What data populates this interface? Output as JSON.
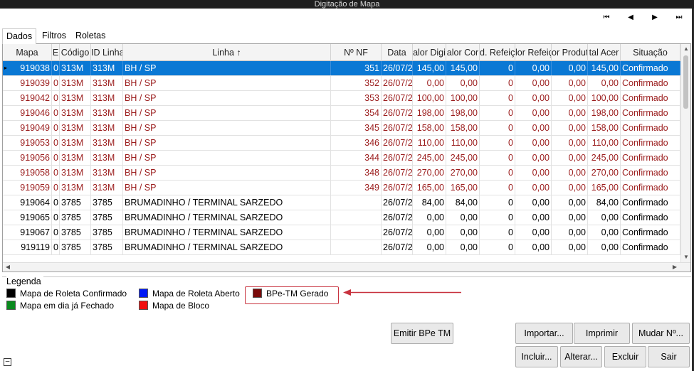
{
  "window": {
    "title": "Digitação de Mapa"
  },
  "nav": {
    "first": "⏮",
    "prev": "◀",
    "next": "▶",
    "last": "⏭"
  },
  "tabs": [
    {
      "label": "Dados"
    },
    {
      "label": "Filtros"
    },
    {
      "label": "Roletas"
    }
  ],
  "grid": {
    "columns": [
      "Mapa",
      "E",
      "Código",
      "ID Linha",
      "Linha ↑",
      "Nº NF",
      "Data",
      "alor Digi",
      "alor Cor",
      "d. Refeiç",
      "lor Refeiç",
      "or Produt",
      "tal Acer",
      "Situação"
    ],
    "rows": [
      {
        "style": "sel",
        "cells": [
          "919038",
          "0",
          "313M",
          "313M",
          "BH / SP",
          "351",
          "26/07/2",
          "145,00",
          "145,00",
          "0",
          "0,00",
          "0,00",
          "145,00",
          "Confirmado"
        ]
      },
      {
        "style": "red",
        "cells": [
          "919039",
          "0",
          "313M",
          "313M",
          "BH / SP",
          "352",
          "26/07/2",
          "0,00",
          "0,00",
          "0",
          "0,00",
          "0,00",
          "0,00",
          "Confirmado"
        ]
      },
      {
        "style": "red",
        "cells": [
          "919042",
          "0",
          "313M",
          "313M",
          "BH / SP",
          "353",
          "26/07/2",
          "100,00",
          "100,00",
          "0",
          "0,00",
          "0,00",
          "100,00",
          "Confirmado"
        ]
      },
      {
        "style": "red",
        "cells": [
          "919046",
          "0",
          "313M",
          "313M",
          "BH / SP",
          "354",
          "26/07/2",
          "198,00",
          "198,00",
          "0",
          "0,00",
          "0,00",
          "198,00",
          "Confirmado"
        ]
      },
      {
        "style": "red",
        "cells": [
          "919049",
          "0",
          "313M",
          "313M",
          "BH / SP",
          "345",
          "26/07/2",
          "158,00",
          "158,00",
          "0",
          "0,00",
          "0,00",
          "158,00",
          "Confirmado"
        ]
      },
      {
        "style": "red",
        "cells": [
          "919053",
          "0",
          "313M",
          "313M",
          "BH / SP",
          "346",
          "26/07/2",
          "110,00",
          "110,00",
          "0",
          "0,00",
          "0,00",
          "110,00",
          "Confirmado"
        ]
      },
      {
        "style": "red",
        "cells": [
          "919056",
          "0",
          "313M",
          "313M",
          "BH / SP",
          "344",
          "26/07/2",
          "245,00",
          "245,00",
          "0",
          "0,00",
          "0,00",
          "245,00",
          "Confirmado"
        ]
      },
      {
        "style": "red",
        "cells": [
          "919058",
          "0",
          "313M",
          "313M",
          "BH / SP",
          "348",
          "26/07/2",
          "270,00",
          "270,00",
          "0",
          "0,00",
          "0,00",
          "270,00",
          "Confirmado"
        ]
      },
      {
        "style": "red",
        "cells": [
          "919059",
          "0",
          "313M",
          "313M",
          "BH / SP",
          "349",
          "26/07/2",
          "165,00",
          "165,00",
          "0",
          "0,00",
          "0,00",
          "165,00",
          "Confirmado"
        ]
      },
      {
        "style": "black",
        "cells": [
          "919064",
          "0",
          "3785",
          "3785",
          "BRUMADINHO / TERMINAL SARZEDO",
          "",
          "26/07/2",
          "84,00",
          "84,00",
          "0",
          "0,00",
          "0,00",
          "84,00",
          "Confirmado"
        ]
      },
      {
        "style": "black",
        "cells": [
          "919065",
          "0",
          "3785",
          "3785",
          "BRUMADINHO / TERMINAL SARZEDO",
          "",
          "26/07/2",
          "0,00",
          "0,00",
          "0",
          "0,00",
          "0,00",
          "0,00",
          "Confirmado"
        ]
      },
      {
        "style": "black",
        "cells": [
          "919067",
          "0",
          "3785",
          "3785",
          "BRUMADINHO / TERMINAL SARZEDO",
          "",
          "26/07/2",
          "0,00",
          "0,00",
          "0",
          "0,00",
          "0,00",
          "0,00",
          "Confirmado"
        ]
      },
      {
        "style": "black",
        "cells": [
          "919119",
          "0",
          "3785",
          "3785",
          "BRUMADINHO / TERMINAL SARZEDO",
          "",
          "26/07/2",
          "0,00",
          "0,00",
          "0",
          "0,00",
          "0,00",
          "0,00",
          "Confirmado"
        ]
      }
    ]
  },
  "legend": {
    "title": "Legenda",
    "items": [
      {
        "label": "Mapa de Roleta Confirmado",
        "color": "#000000"
      },
      {
        "label": "Mapa em dia já Fechado",
        "color": "#0a8a1e"
      },
      {
        "label": "Mapa de Roleta Aberto",
        "color": "#0018f5"
      },
      {
        "label": "Mapa de Bloco",
        "color": "#f20e0e"
      },
      {
        "label": "BPe-TM Gerado",
        "color": "#7a0a0a"
      }
    ],
    "highlight_color": "#c8323e"
  },
  "buttons": {
    "emitir": "Emitir BPe TM",
    "importar": "Importar...",
    "imprimir": "Imprimir",
    "mudar": "Mudar Nº...",
    "incluir": "Incluir...",
    "alterar": "Alterar...",
    "excluir": "Excluir",
    "sair": "Sair"
  }
}
